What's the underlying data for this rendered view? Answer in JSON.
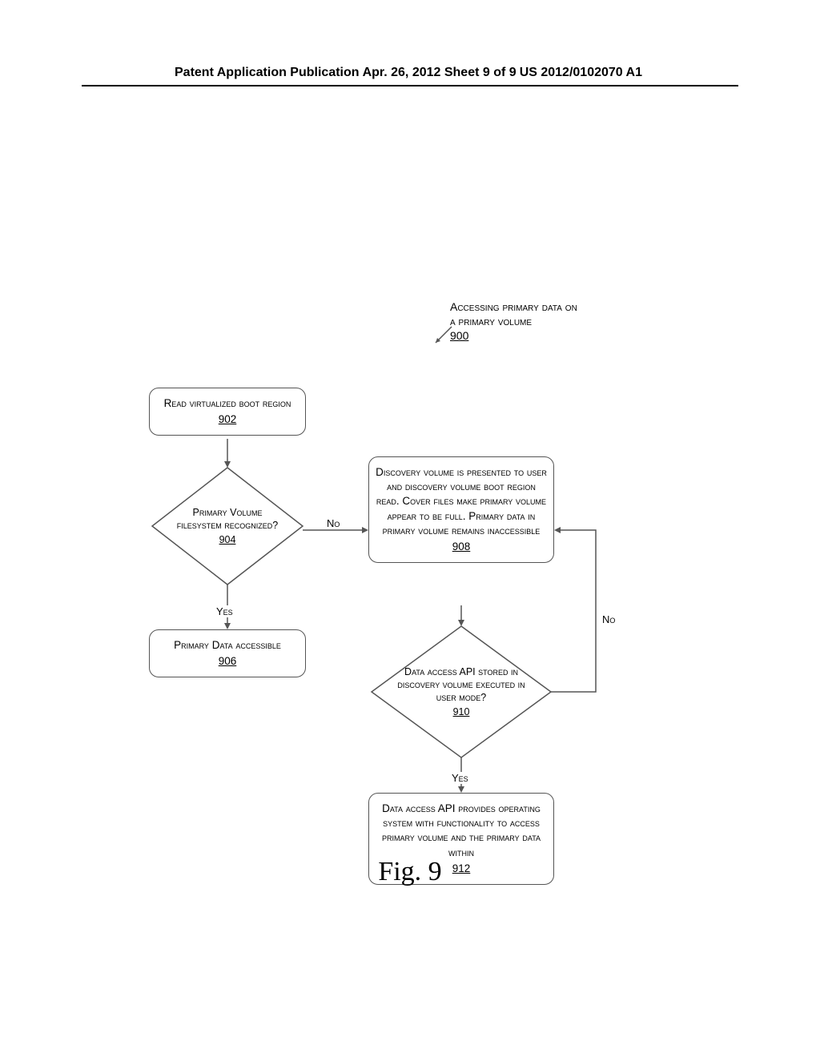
{
  "header": {
    "left": "Patent Application Publication",
    "mid": "Apr. 26, 2012  Sheet 9 of 9",
    "right": "US 2012/0102070 A1"
  },
  "title": {
    "line1": "Accessing primary data on",
    "line2": "a primary volume",
    "ref": "900"
  },
  "box902": {
    "text": "Read virtualized boot region",
    "ref": "902"
  },
  "d904": {
    "text": "Primary Volume filesystem recognized?",
    "ref": "904"
  },
  "box906": {
    "text": "Primary Data accessible",
    "ref": "906"
  },
  "box908": {
    "text": "Discovery volume is presented to user and discovery volume boot region read. Cover files make primary volume appear to be full. Primary data in primary volume remains inaccessible",
    "ref": "908"
  },
  "d910": {
    "text": "Data access API stored in discovery volume executed in user mode?",
    "ref": "910"
  },
  "box912": {
    "text": "Data access API provides operating system with functionality to access primary volume and the primary data within",
    "ref": "912"
  },
  "labels": {
    "yes": "Yes",
    "no": "No"
  },
  "figure": "Fig. 9"
}
